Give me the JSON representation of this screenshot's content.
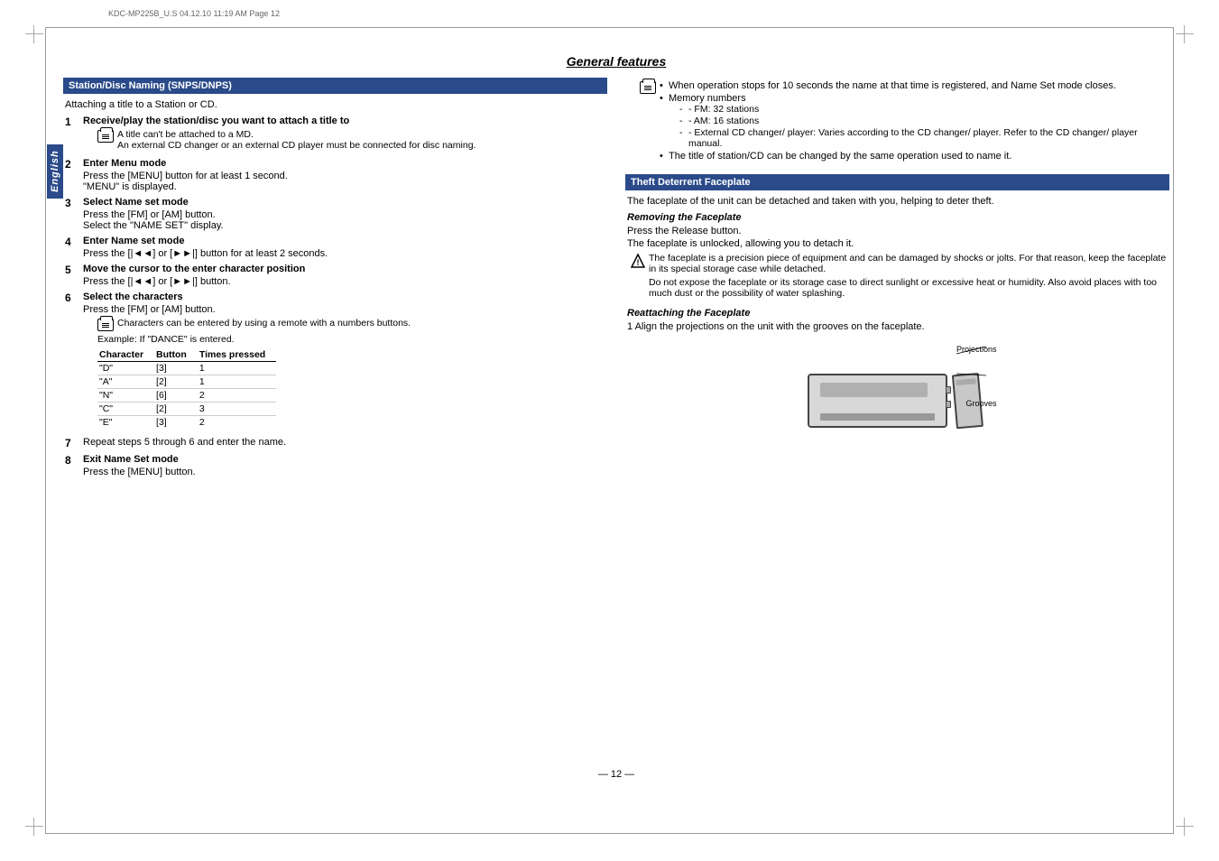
{
  "page": {
    "print_info": "KDC-MP225B_U.S   04.12.10   11:19 AM   Page 12",
    "page_number": "— 12 —",
    "title": "General features",
    "sidebar_label": "English"
  },
  "left_section": {
    "header": "Station/Disc Naming (SNPS/DNPS)",
    "intro": "Attaching a title to a Station or CD.",
    "steps": [
      {
        "number": "1",
        "title": "Receive/play the station/disc you want to attach a title to",
        "notes": [
          "A title can't be attached to a MD.",
          "An external CD changer or an external CD player must be connected for disc naming."
        ]
      },
      {
        "number": "2",
        "title": "Enter Menu mode",
        "body1": "Press the [MENU] button for at least 1 second.",
        "body2": "\"MENU\" is displayed."
      },
      {
        "number": "3",
        "title": "Select Name set mode",
        "body1": "Press the [FM] or [AM] button.",
        "body2": "Select the \"NAME SET\" display."
      },
      {
        "number": "4",
        "title": "Enter Name set mode",
        "body1": "Press the [|◄◄] or [►►|] button for at least 2 seconds."
      },
      {
        "number": "5",
        "title": "Move the cursor to the enter character position",
        "body1": "Press the [|◄◄] or [►►|] button."
      },
      {
        "number": "6",
        "title": "Select the characters",
        "body1": "Press the [FM] or [AM] button.",
        "remote_note": "Characters can be entered by using a remote with a numbers buttons.",
        "example_label": "Example: If \"DANCE\" is entered.",
        "table": {
          "headers": [
            "Character",
            "Button",
            "Times pressed"
          ],
          "rows": [
            [
              "\"D\"",
              "[3]",
              "1"
            ],
            [
              "\"A\"",
              "[2]",
              "1"
            ],
            [
              "\"N\"",
              "[6]",
              "2"
            ],
            [
              "\"C\"",
              "[2]",
              "3"
            ],
            [
              "\"E\"",
              "[3]",
              "2"
            ]
          ]
        }
      },
      {
        "number": "7",
        "title": "Repeat steps 5 through 6 and enter the name."
      },
      {
        "number": "8",
        "title": "Exit Name Set mode",
        "body1": "Press the [MENU] button."
      }
    ]
  },
  "right_section": {
    "naming_notes": [
      "When operation stops for 10 seconds the name at that time is registered, and Name Set mode closes.",
      "Memory numbers",
      "FM: 32 stations",
      "AM: 16 stations",
      "External CD changer/ player: Varies according to the CD changer/ player. Refer to the CD changer/ player manual.",
      "The title of station/CD can be changed by the same operation used to name it."
    ],
    "memory_numbers_sub": [
      "- FM: 32 stations",
      "- AM: 16 stations",
      "- External CD changer/ player: Varies according to the CD changer/ player. Refer to the CD changer/ player manual."
    ],
    "theft_section": {
      "header": "Theft Deterrent Faceplate",
      "intro": "The faceplate of the unit can be detached and taken with you, helping to deter theft.",
      "removing": {
        "title": "Removing the Faceplate",
        "body1": "Press the Release button.",
        "body2": "The faceplate is unlocked, allowing you to detach it.",
        "warnings": [
          "The faceplate is a precision piece of equipment and can be damaged by shocks or jolts. For that reason, keep the faceplate in its special storage case while detached.",
          "Do not expose the faceplate or its storage case to direct sunlight or excessive heat or humidity. Also avoid places with too much dust or the possibility of water splashing."
        ]
      },
      "reattaching": {
        "title": "Reattaching the Faceplate",
        "step1": "1   Align the projections on the unit with the grooves on the faceplate.",
        "label_projections": "Projections",
        "label_grooves": "Grooves"
      }
    }
  }
}
